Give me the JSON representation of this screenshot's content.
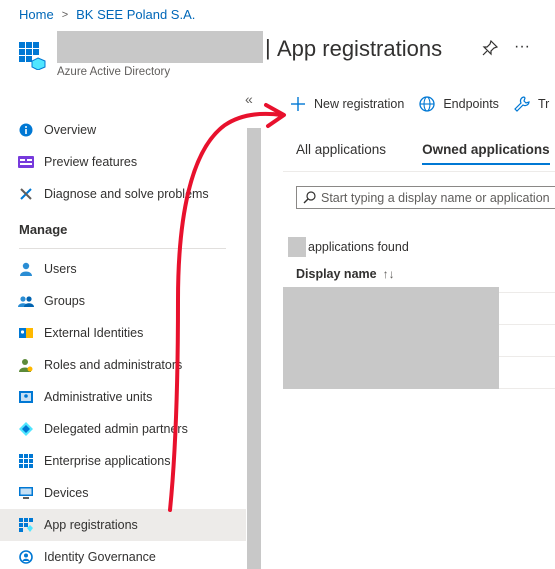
{
  "breadcrumb": {
    "home": "Home",
    "separator": ">",
    "tenant": "BK SEE Poland S.A."
  },
  "header": {
    "title_separator": "|",
    "title": "App registrations",
    "subtitle": "Azure Active Directory",
    "more_label": "···",
    "app_icon": "azure-ad-grid-icon",
    "pin_icon": "pin-icon"
  },
  "sidebar": {
    "collapse_label": "«",
    "top_items": [
      {
        "label": "Overview",
        "icon": "info-icon"
      },
      {
        "label": "Preview features",
        "icon": "preview-icon"
      },
      {
        "label": "Diagnose and solve problems",
        "icon": "wrench-icon"
      }
    ],
    "section_title": "Manage",
    "items": [
      {
        "label": "Users",
        "icon": "user-icon"
      },
      {
        "label": "Groups",
        "icon": "group-icon"
      },
      {
        "label": "External Identities",
        "icon": "external-identities-icon"
      },
      {
        "label": "Roles and administrators",
        "icon": "roles-icon"
      },
      {
        "label": "Administrative units",
        "icon": "admin-units-icon"
      },
      {
        "label": "Delegated admin partners",
        "icon": "partners-icon"
      },
      {
        "label": "Enterprise applications",
        "icon": "enterprise-apps-icon"
      },
      {
        "label": "Devices",
        "icon": "devices-icon"
      },
      {
        "label": "App registrations",
        "icon": "app-registrations-icon",
        "active": true
      },
      {
        "label": "Identity Governance",
        "icon": "identity-governance-icon"
      }
    ]
  },
  "toolbar": {
    "new_registration": "New registration",
    "endpoints": "Endpoints",
    "troubleshoot": "Tr"
  },
  "tabs": [
    {
      "label": "All applications",
      "selected": false
    },
    {
      "label": "Owned applications",
      "selected": true
    }
  ],
  "search": {
    "placeholder": "Start typing a display name or application"
  },
  "results": {
    "found_text": "applications found"
  },
  "table": {
    "column_display_name": "Display name",
    "sort_indicator": "↑↓"
  },
  "colors": {
    "accent": "#0078d4",
    "link": "#0067b8",
    "annotation_arrow": "#e8112d",
    "redaction": "#c8c8c8"
  }
}
